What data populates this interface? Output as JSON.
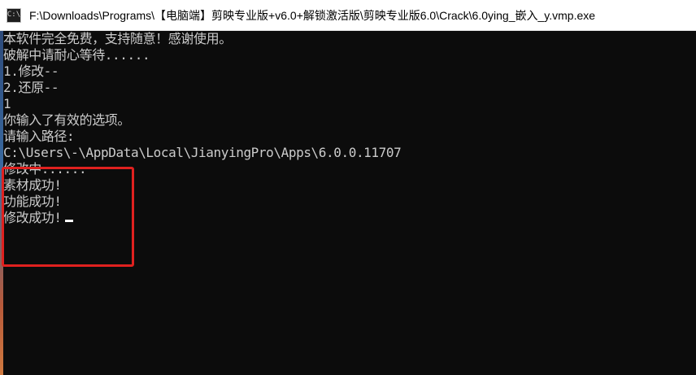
{
  "window": {
    "title": "F:\\Downloads\\Programs\\【电脑端】剪映专业版+v6.0+解锁激活版\\剪映专业版6.0\\Crack\\6.0ying_嵌入_y.vmp.exe",
    "icon": "console-app-icon"
  },
  "console": {
    "lines": [
      "本软件完全免费，支持随意！感谢使用。",
      "破解中请耐心等待......",
      "1.修改--",
      "2.还原--",
      "1",
      "你输入了有效的选项。",
      "请输入路径:",
      "C:\\Users\\-\\AppData\\Local\\JianyingPro\\Apps\\6.0.0.11707",
      "修改中......",
      "素材成功!",
      "功能成功!",
      "修改成功!"
    ]
  },
  "colors": {
    "console_bg": "#0c0c0c",
    "console_text": "#cccccc",
    "highlight": "#e0211f"
  }
}
